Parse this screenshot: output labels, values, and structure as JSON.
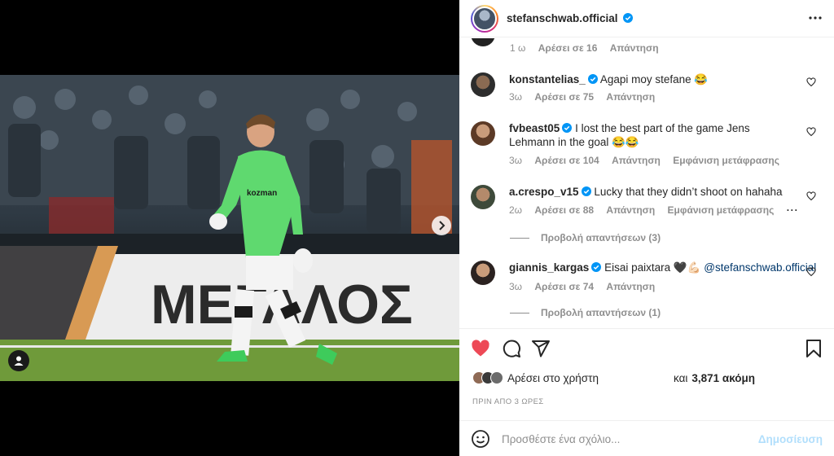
{
  "post": {
    "username": "stefanschwab.official"
  },
  "comments": {
    "top_meta": {
      "time": "1 ω",
      "likes": "Αρέσει σε 16",
      "reply": "Απάντηση"
    },
    "items": [
      {
        "username": "konstantelias_",
        "text": "Agapi moy stefane 😂",
        "time": "3ω",
        "likes": "Αρέσει σε 75",
        "reply": "Απάντηση",
        "translate": ""
      },
      {
        "username": "fvbeast05",
        "text": "I lost the best part of the game Jens Lehmann in the goal 😂😂",
        "time": "3ω",
        "likes": "Αρέσει σε 104",
        "reply": "Απάντηση",
        "translate": "Εμφάνιση μετάφρασης"
      },
      {
        "username": "a.crespo_v15",
        "text": "Lucky that they didn’t shoot on hahaha",
        "time": "2ω",
        "likes": "Αρέσει σε 88",
        "reply": "Απάντηση",
        "translate": "Εμφάνιση μετάφρασης"
      },
      {
        "username": "giannis_kargas",
        "text": "Eisai paixtara 🖤💪🏻",
        "mention": "@stefanschwab.official",
        "time": "3ω",
        "likes": "Αρέσει σε 74",
        "reply": "Απάντηση",
        "translate": ""
      }
    ],
    "view_replies_1": "Προβολή απαντήσεων (3)",
    "view_replies_2": "Προβολή απαντήσεων (1)"
  },
  "likes": {
    "prefix": "Αρέσει στο χρήστη",
    "middle": "και",
    "count": "3,871 ακόμη"
  },
  "timestamp": "ΠΡΙΝ ΑΠΟ 3 ΩΡΕΣ",
  "add_comment": {
    "placeholder": "Προσθέστε ένα σχόλιο...",
    "post_label": "Δημοσίευση"
  },
  "colors": {
    "like_red": "#ed4956",
    "verified_blue": "#0095f6",
    "post_disabled": "#b2dffc"
  },
  "icons": {
    "like": "heart-icon",
    "comment": "comment-bubble-icon",
    "share": "paper-plane-icon",
    "save": "bookmark-icon",
    "emoji": "emoji-icon",
    "more": "ellipsis-icon",
    "next": "chevron-right-icon",
    "tag": "user-tag-icon"
  }
}
